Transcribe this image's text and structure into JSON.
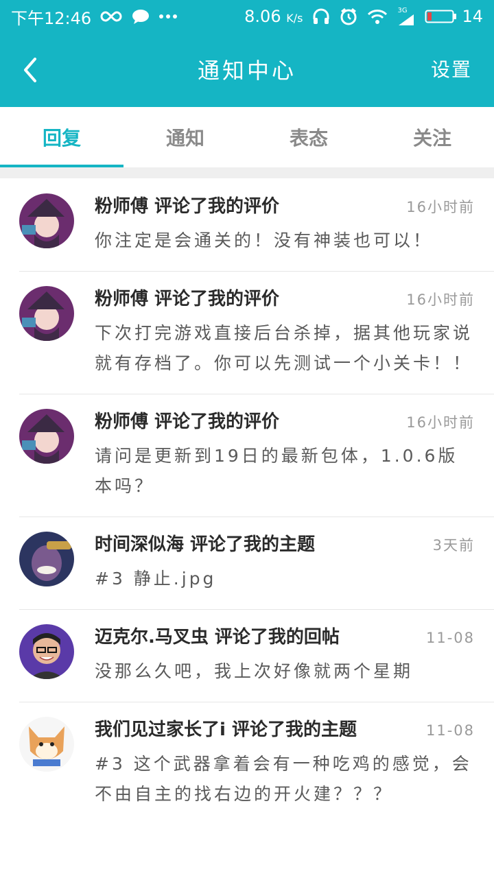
{
  "status_bar": {
    "time": "下午12:46",
    "speed": "8.06",
    "speed_unit": "K/s",
    "signal_label": "3G",
    "battery": "14"
  },
  "app_bar": {
    "title": "通知中心",
    "settings_label": "设置"
  },
  "tabs": [
    {
      "label": "回复",
      "active": true
    },
    {
      "label": "通知",
      "active": false
    },
    {
      "label": "表态",
      "active": false
    },
    {
      "label": "关注",
      "active": false
    }
  ],
  "colors": {
    "accent": "#15b5c4",
    "muted_text": "#9a9a9a"
  },
  "notifications": [
    {
      "headline": "粉师傅 评论了我的评价",
      "time": "16小时前",
      "content": "你注定是会通关的！没有神装也可以！",
      "avatar": "witch-avatar"
    },
    {
      "headline": "粉师傅 评论了我的评价",
      "time": "16小时前",
      "content": "下次打完游戏直接后台杀掉，据其他玩家说就有存档了。你可以先测试一个小关卡！！",
      "avatar": "witch-avatar"
    },
    {
      "headline": "粉师傅 评论了我的评价",
      "time": "16小时前",
      "content": "请问是更新到19日的最新包体，1.0.6版本吗？",
      "avatar": "witch-avatar"
    },
    {
      "headline": "时间深似海 评论了我的主题",
      "time": "3天前",
      "content": "#3 静止.jpg",
      "avatar": "thanos-avatar"
    },
    {
      "headline": "迈克尔.马叉虫 评论了我的回帖",
      "time": "11-08",
      "content": "没那么久吧，我上次好像就两个星期",
      "avatar": "man-glasses-avatar"
    },
    {
      "headline": "我们见过家长了i 评论了我的主题",
      "time": "11-08",
      "content": "#3 这个武器拿着会有一种吃鸡的感觉，会不由自主的找右边的开火建？？？",
      "avatar": "shiba-avatar"
    }
  ]
}
